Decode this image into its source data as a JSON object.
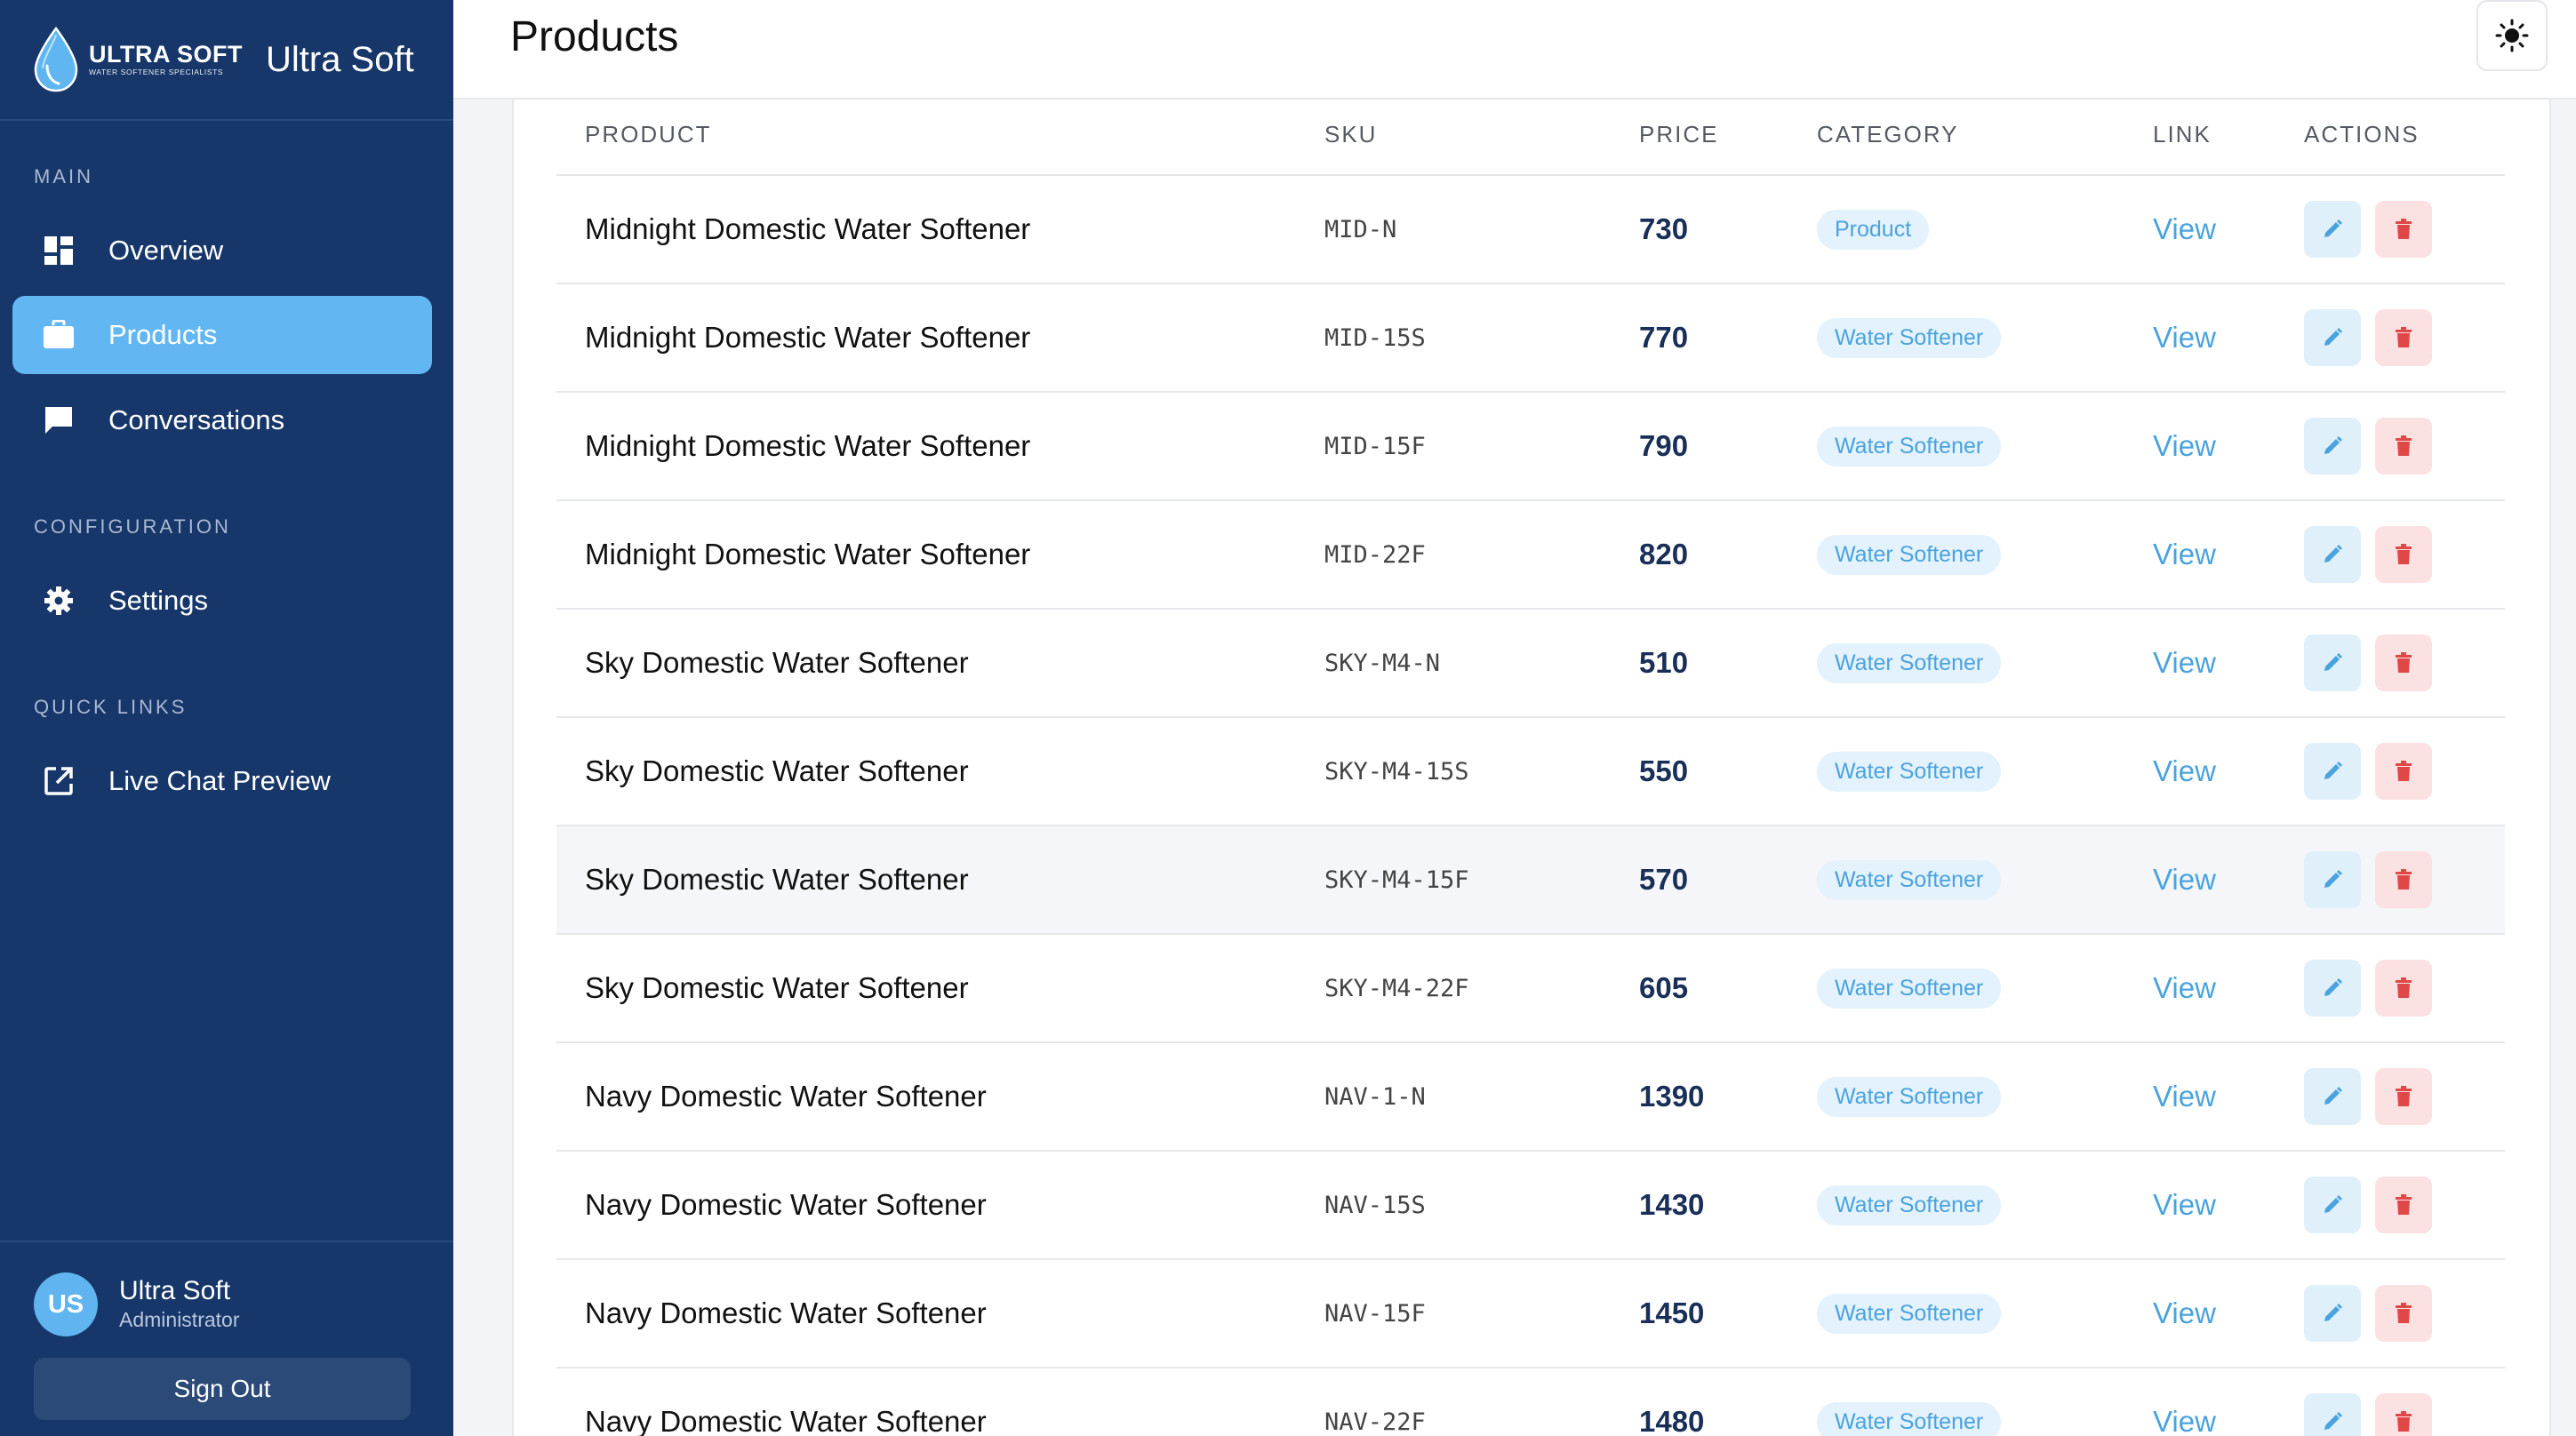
{
  "brand": {
    "logo_main": "ULTRA SOFT",
    "logo_sub": "WATER SOFTENER SPECIALISTS",
    "name": "Ultra Soft"
  },
  "sidebar": {
    "sections": {
      "main": "MAIN",
      "configuration": "CONFIGURATION",
      "quick_links": "QUICK LINKS"
    },
    "items": [
      {
        "label": "Overview",
        "icon": "dashboard-icon"
      },
      {
        "label": "Products",
        "icon": "briefcase-icon",
        "active": true
      },
      {
        "label": "Conversations",
        "icon": "chat-icon"
      },
      {
        "label": "Settings",
        "icon": "gear-icon"
      },
      {
        "label": "Live Chat Preview",
        "icon": "external-link-icon"
      }
    ]
  },
  "user": {
    "initials": "US",
    "name": "Ultra Soft",
    "role": "Administrator",
    "sign_out": "Sign Out"
  },
  "header": {
    "title": "Products",
    "theme_icon": "sun-icon"
  },
  "table": {
    "columns": [
      "PRODUCT",
      "SKU",
      "PRICE",
      "CATEGORY",
      "LINK",
      "ACTIONS"
    ],
    "rows": [
      {
        "name": "Midnight Domestic Water Softener",
        "sku": "MID-N",
        "price": "730",
        "category": "Product",
        "link": "View"
      },
      {
        "name": "Midnight Domestic Water Softener",
        "sku": "MID-15S",
        "price": "770",
        "category": "Water Softener",
        "link": "View"
      },
      {
        "name": "Midnight Domestic Water Softener",
        "sku": "MID-15F",
        "price": "790",
        "category": "Water Softener",
        "link": "View"
      },
      {
        "name": "Midnight Domestic Water Softener",
        "sku": "MID-22F",
        "price": "820",
        "category": "Water Softener",
        "link": "View"
      },
      {
        "name": "Sky Domestic Water Softener",
        "sku": "SKY-M4-N",
        "price": "510",
        "category": "Water Softener",
        "link": "View"
      },
      {
        "name": "Sky Domestic Water Softener",
        "sku": "SKY-M4-15S",
        "price": "550",
        "category": "Water Softener",
        "link": "View"
      },
      {
        "name": "Sky Domestic Water Softener",
        "sku": "SKY-M4-15F",
        "price": "570",
        "category": "Water Softener",
        "link": "View"
      },
      {
        "name": "Sky Domestic Water Softener",
        "sku": "SKY-M4-22F",
        "price": "605",
        "category": "Water Softener",
        "link": "View"
      },
      {
        "name": "Navy Domestic Water Softener",
        "sku": "NAV-1-N",
        "price": "1390",
        "category": "Water Softener",
        "link": "View"
      },
      {
        "name": "Navy Domestic Water Softener",
        "sku": "NAV-15S",
        "price": "1430",
        "category": "Water Softener",
        "link": "View"
      },
      {
        "name": "Navy Domestic Water Softener",
        "sku": "NAV-15F",
        "price": "1450",
        "category": "Water Softener",
        "link": "View"
      },
      {
        "name": "Navy Domestic Water Softener",
        "sku": "NAV-22F",
        "price": "1480",
        "category": "Water Softener",
        "link": "View"
      }
    ]
  },
  "colors": {
    "sidebar_bg": "#17376a",
    "active_item": "#62b7f3",
    "link": "#4aa3de",
    "delete": "#e04848"
  }
}
